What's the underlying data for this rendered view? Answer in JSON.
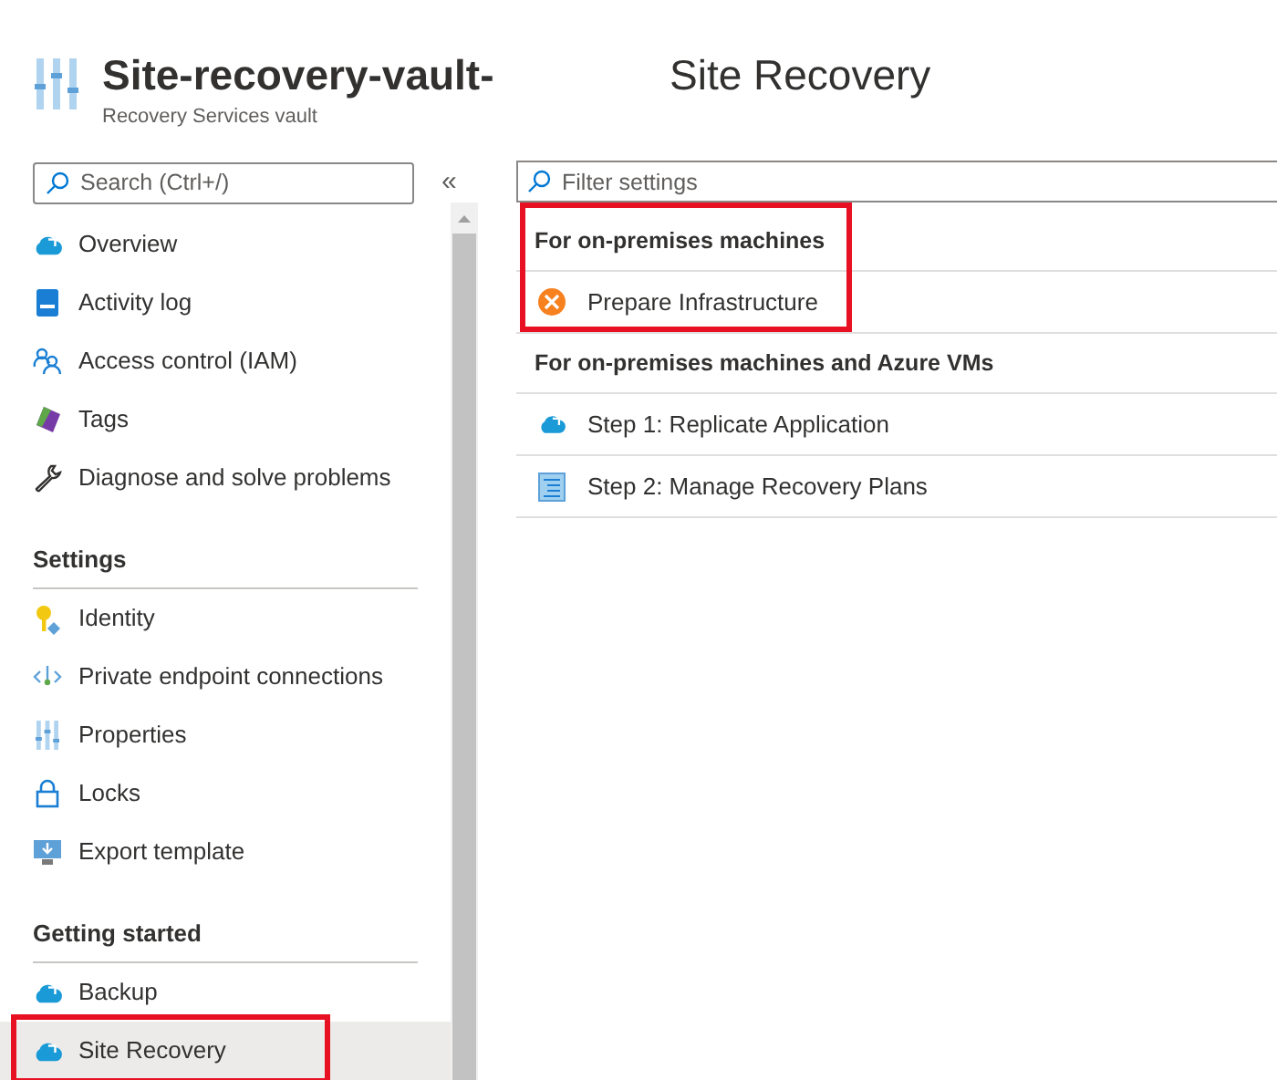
{
  "header": {
    "title": "Site-recovery-vault-",
    "subtitle": "Recovery Services vault",
    "page_title": "Site Recovery"
  },
  "sidebar": {
    "search": {
      "placeholder": "Search (Ctrl+/)"
    },
    "collapse": "«",
    "sections": [
      {
        "items": [
          {
            "label": "Overview",
            "selected": false,
            "highlighted": false
          },
          {
            "label": "Activity log",
            "selected": false,
            "highlighted": false
          },
          {
            "label": "Access control (IAM)",
            "selected": false,
            "highlighted": false
          },
          {
            "label": "Tags",
            "selected": false,
            "highlighted": false
          },
          {
            "label": "Diagnose and solve problems",
            "selected": false,
            "highlighted": false
          }
        ]
      },
      {
        "title": "Settings",
        "items": [
          {
            "label": "Identity",
            "selected": false,
            "highlighted": false
          },
          {
            "label": "Private endpoint connections",
            "selected": false,
            "highlighted": false
          },
          {
            "label": "Properties",
            "selected": false,
            "highlighted": false
          },
          {
            "label": "Locks",
            "selected": false,
            "highlighted": false
          },
          {
            "label": "Export template",
            "selected": false,
            "highlighted": false
          }
        ]
      },
      {
        "title": "Getting started",
        "items": [
          {
            "label": "Backup",
            "selected": false,
            "highlighted": false
          },
          {
            "label": "Site Recovery",
            "selected": true,
            "highlighted": true
          }
        ]
      }
    ]
  },
  "main": {
    "filter": {
      "placeholder": "Filter settings"
    },
    "groups": [
      {
        "title": "For on-premises machines",
        "highlighted": true,
        "items": [
          {
            "label": "Prepare Infrastructure"
          }
        ]
      },
      {
        "title": "For on-premises machines and Azure VMs",
        "highlighted": false,
        "items": [
          {
            "label": "Step 1: Replicate Application"
          },
          {
            "label": "Step 2: Manage Recovery Plans"
          }
        ]
      }
    ]
  }
}
